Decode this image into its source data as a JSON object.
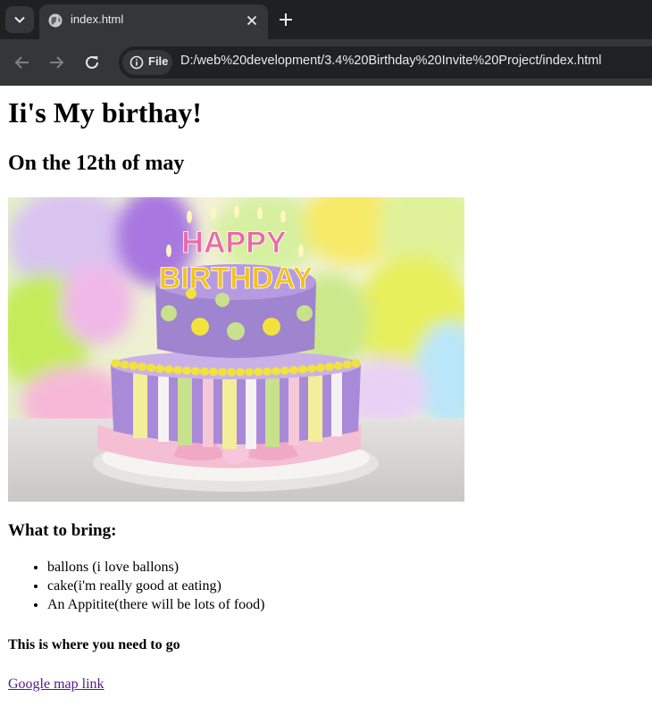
{
  "browser": {
    "tab_title": "index.html",
    "site_chip_label": "File",
    "url": "D:/web%20development/3.4%20Birthday%20Invite%20Project/index.html",
    "icons": {
      "tab_menu": "chevron-down-icon",
      "favicon": "globe-icon",
      "tab_close": "close-icon",
      "new_tab": "plus-icon",
      "back": "arrow-left-icon",
      "forward": "arrow-right-icon",
      "reload": "reload-icon",
      "site_info": "info-icon"
    }
  },
  "page": {
    "heading": "Ii's My birthay!",
    "subheading": "On the 12th of may",
    "bring_heading": "What to bring:",
    "bring_items": [
      "ballons (i love ballons)",
      "cake(i'm really good at eating)",
      "An Appitite(there will be lots of food)"
    ],
    "where_heading": "This is where you need to go",
    "map_link": "Google map link",
    "cake_topper": {
      "line1": "HAPPY",
      "line2": "BIRTHDAY"
    }
  },
  "colors": {
    "chrome_dark": "#1f2022",
    "chrome_tab": "#35363a",
    "link_visited": "#551a8b"
  }
}
